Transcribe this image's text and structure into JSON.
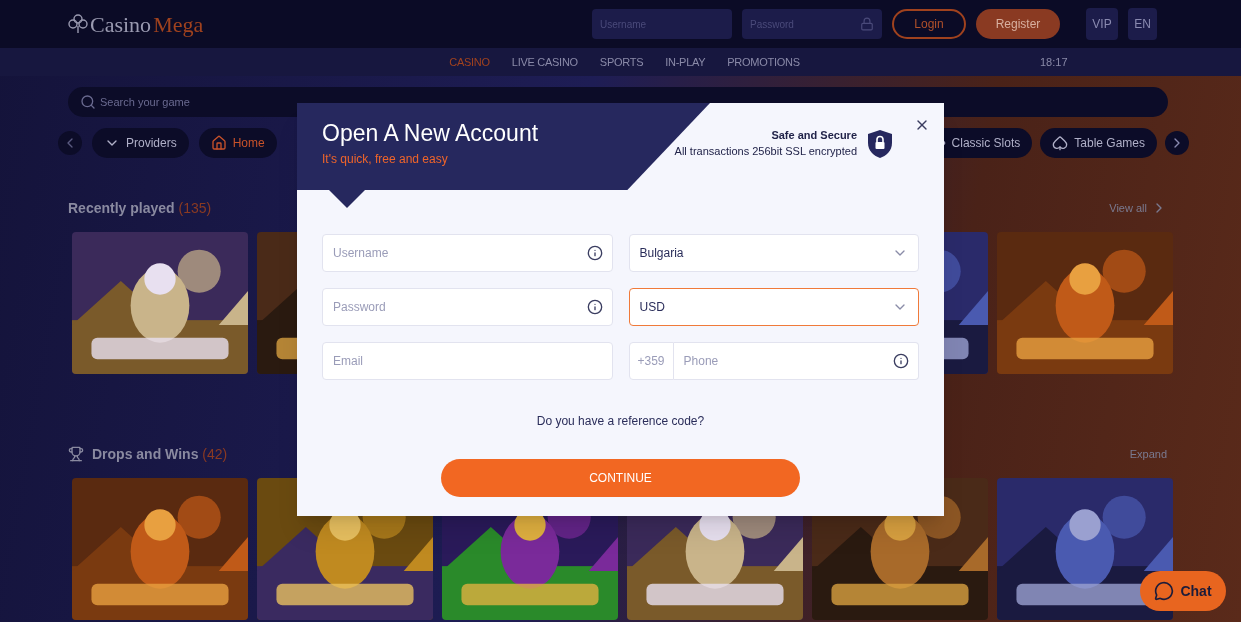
{
  "header": {
    "logo": {
      "part_1": "Casino",
      "part_2": "Mega"
    },
    "username_placeholder": "Username",
    "password_placeholder": "Password",
    "login": "Login",
    "register": "Register",
    "vip": "VIP",
    "language": "EN"
  },
  "nav": {
    "items": [
      {
        "label": "CASINO",
        "selected": true
      },
      {
        "label": "LIVE CASINO",
        "selected": false
      },
      {
        "label": "SPORTS",
        "selected": false
      },
      {
        "label": "IN-PLAY",
        "selected": false
      },
      {
        "label": "PROMOTIONS",
        "selected": false
      }
    ],
    "time": "18:17"
  },
  "search": {
    "placeholder": "Search your game"
  },
  "categories": {
    "left": [
      {
        "label": "Providers",
        "selected": false
      },
      {
        "label": "Home",
        "selected": true
      }
    ],
    "right": [
      {
        "label": "Classic Slots",
        "selected": false
      },
      {
        "label": "Table Games",
        "selected": false
      }
    ]
  },
  "sections": [
    {
      "title": "Recently played",
      "count": "(135)",
      "link": "View all"
    },
    {
      "title": "Drops and Wins",
      "count": "(42)",
      "link": "Expand"
    }
  ],
  "modal": {
    "title": "Open A New Account",
    "subtitle": "It's quick, free and easy",
    "secure_title": "Safe and Secure",
    "secure_text": "All transactions 256bit SSL encrypted",
    "fields": [
      {
        "kind": "text",
        "placeholder": "Username",
        "info": true,
        "focused": false
      },
      {
        "kind": "select",
        "value": "Bulgaria",
        "focused": false
      },
      {
        "kind": "text",
        "placeholder": "Password",
        "info": true,
        "focused": false
      },
      {
        "kind": "select",
        "value": "USD",
        "focused": true
      },
      {
        "kind": "text",
        "placeholder": "Email",
        "info": false,
        "focused": false
      },
      {
        "kind": "phone",
        "prefix": "+359",
        "placeholder": "Phone",
        "info": true,
        "focused": false
      }
    ],
    "reference_question": "Do you have a reference code?",
    "continue": "CONTINUE"
  },
  "chat": {
    "label": "Chat"
  }
}
